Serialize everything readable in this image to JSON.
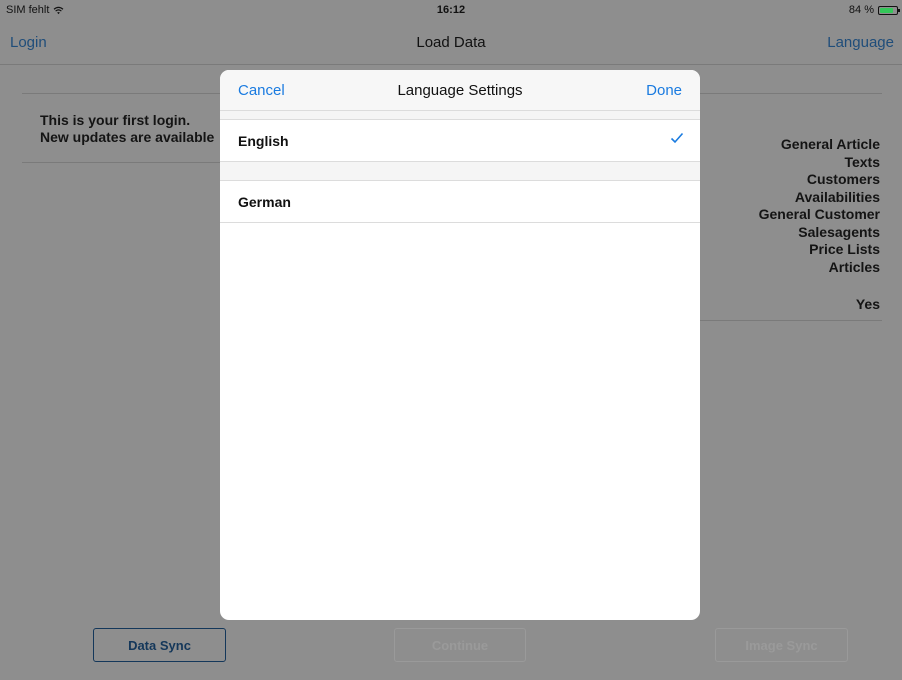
{
  "status_bar": {
    "carrier": "SIM fehlt",
    "time": "16:12",
    "battery_text": "84 %",
    "battery_level": 0.84,
    "battery_color": "#34c759"
  },
  "nav": {
    "left": "Login",
    "title": "Load Data",
    "right": "Language"
  },
  "notice": {
    "line1": "This is your first login.",
    "line2": "New updates are available"
  },
  "updates": [
    "General Article",
    "Texts",
    "Customers",
    "Availabilities",
    "General Customer",
    "Salesagents",
    "Price Lists",
    "Articles"
  ],
  "yes_value": "Yes",
  "buttons": {
    "data_sync": "Data Sync",
    "continue": "Continue",
    "image_sync": "Image Sync"
  },
  "modal": {
    "cancel": "Cancel",
    "title": "Language Settings",
    "done": "Done",
    "languages": [
      {
        "label": "English",
        "selected": true
      },
      {
        "label": "German",
        "selected": false
      }
    ],
    "check_icon": "checkmark-icon",
    "accent_color": "#1a7be0"
  }
}
